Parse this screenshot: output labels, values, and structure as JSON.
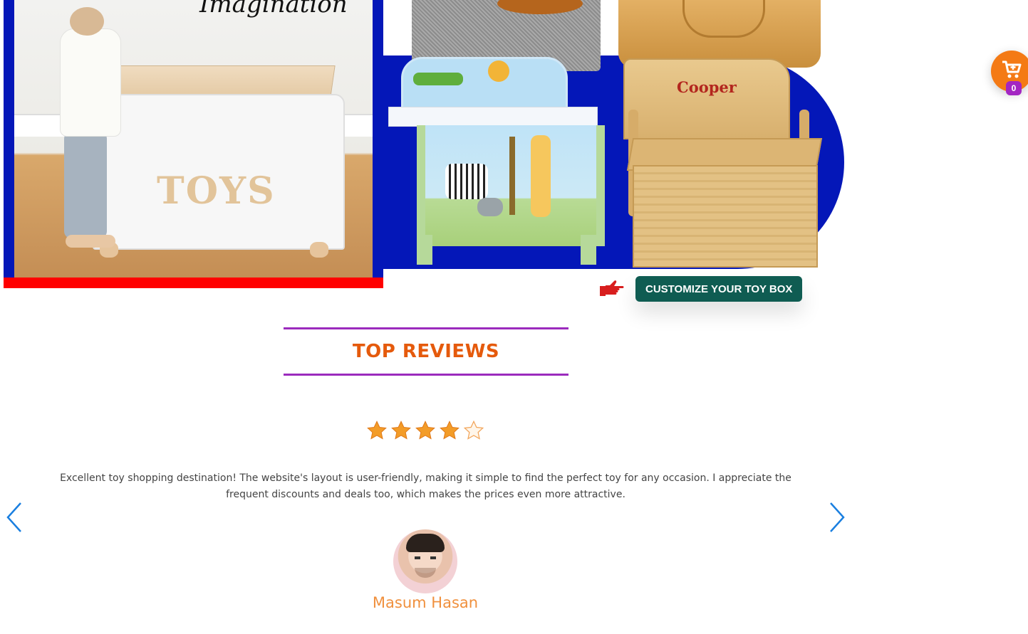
{
  "hero": {
    "left_image_caption": "Imagination",
    "toybox_label": "TOYS",
    "bench_name": "Cooper"
  },
  "cta": {
    "label": "CUSTOMIZE YOUR TOY BOX",
    "icon": "pointing-hand-icon"
  },
  "cart": {
    "icon": "cart-icon",
    "count": "0"
  },
  "reviews": {
    "title": "TOP REVIEWS",
    "rating": 4,
    "rating_max": 5,
    "text": "Excellent toy shopping destination! The website's layout is user-friendly, making it simple to find the perfect toy for any occasion. I appreciate the frequent discounts and deals too, which makes the prices even more attractive.",
    "reviewer_name": "Masum Hasan"
  },
  "colors": {
    "hero_blue": "#0417b8",
    "accent_red": "#ff0000",
    "cta_green": "#0f5c52",
    "heading_orange": "#e55a0c",
    "rule_purple": "#9b2bbd",
    "star_orange": "#f39c28",
    "arrow_blue": "#1a7fe0",
    "cart_orange": "#f47a15",
    "badge_purple": "#a326c2",
    "name_orange": "#f0903d"
  }
}
